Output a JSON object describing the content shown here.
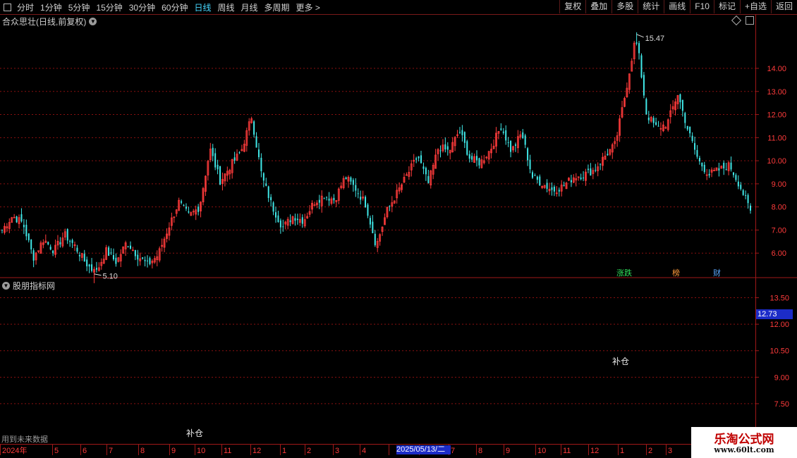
{
  "toolbar": {
    "periods": [
      "分时",
      "1分钟",
      "5分钟",
      "15分钟",
      "30分钟",
      "60分钟",
      "日线",
      "周线",
      "月线",
      "多周期",
      "更多 >"
    ],
    "active_period": "日线",
    "right_buttons": [
      "复权",
      "叠加",
      "多股",
      "统计",
      "画线",
      "F10",
      "标记",
      "+自选",
      "返回"
    ]
  },
  "main_panel": {
    "title": "合众思壮(日线,前复权)",
    "high_label": "15.47",
    "low_label": "5.10",
    "event_tags": [
      {
        "text": "涨跌",
        "color": "#2ee05a"
      },
      {
        "text": "榜",
        "color": "#ff9a3a"
      },
      {
        "text": "财",
        "color": "#5aa7ff"
      }
    ]
  },
  "indicator_panel": {
    "title": "股朋指标网",
    "signal_label_1": "补仓",
    "signal_label_2": "补仓",
    "note": "用到未来数据",
    "price_box": "12.73"
  },
  "cursor_date": "2025/05/13/二",
  "watermark": {
    "title": "乐淘公式网",
    "url": "www.60lt.com"
  },
  "colors": {
    "up": "#ff3b3b",
    "down": "#40e8e8",
    "grid": "#8a1010",
    "axis_text": "#ff3b3b"
  },
  "chart_data": [
    {
      "type": "candlestick",
      "title": "合众思壮(日线,前复权)",
      "y_ticks": [
        "14.00",
        "13.00",
        "12.00",
        "11.00",
        "10.00",
        "9.00",
        "8.00",
        "7.00",
        "6.00"
      ],
      "ylim": [
        5.0,
        15.8
      ],
      "x_ticks": [
        "2024年",
        "5",
        "6",
        "7",
        "8",
        "9",
        "10",
        "11",
        "12",
        "1",
        "2",
        "3",
        "4",
        "5",
        "6",
        "7",
        "8",
        "9",
        "10",
        "11",
        "12",
        "1",
        "2",
        "3"
      ],
      "max_value": 15.47,
      "min_value": 5.1,
      "close_path": [
        7.0,
        7.6,
        7.3,
        5.8,
        6.6,
        6.1,
        6.8,
        6.3,
        5.6,
        5.1,
        6.1,
        5.6,
        6.5,
        5.9,
        5.5,
        5.9,
        7.1,
        8.2,
        7.6,
        8.0,
        10.5,
        9.1,
        9.8,
        10.4,
        11.9,
        9.3,
        8.0,
        7.1,
        7.6,
        7.4,
        8.2,
        8.5,
        8.3,
        9.3,
        8.8,
        8.1,
        6.3,
        7.8,
        8.6,
        9.4,
        10.2,
        9.0,
        10.6,
        10.4,
        11.3,
        10.1,
        9.9,
        10.5,
        11.5,
        10.4,
        11.2,
        9.3,
        9.0,
        8.7,
        8.9,
        9.3,
        9.4,
        9.6,
        10.2,
        10.7,
        13.0,
        15.47,
        12.0,
        11.4,
        11.6,
        12.9,
        11.3,
        10.0,
        9.4,
        9.6,
        9.8,
        8.9,
        7.8
      ]
    },
    {
      "type": "line",
      "title": "股朋指标网",
      "y_ticks": [
        "13.50",
        "12.00",
        "10.50",
        "9.00",
        "7.50"
      ],
      "ylim": [
        6.5,
        14.0
      ],
      "series": []
    }
  ]
}
